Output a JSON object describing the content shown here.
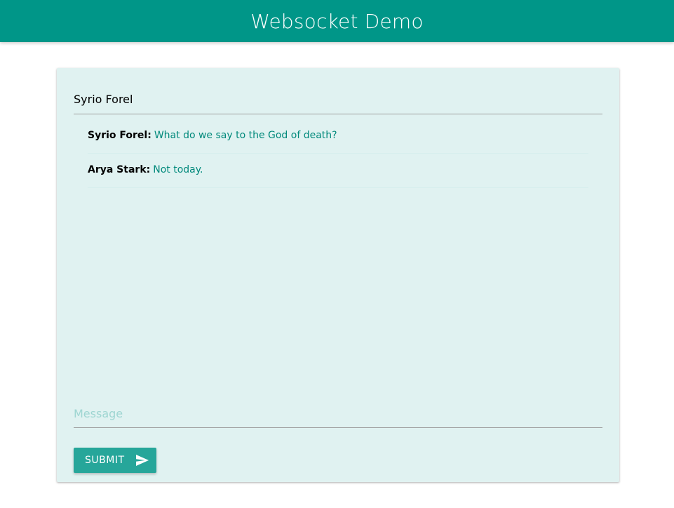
{
  "header": {
    "title": "Websocket Demo"
  },
  "chat": {
    "name_value": "Syrio Forel",
    "messages": [
      {
        "author": "Syrio Forel:",
        "text": "What do we say to the God of death?"
      },
      {
        "author": "Arya Stark:",
        "text": "Not today."
      }
    ],
    "message_placeholder": "Message",
    "message_value": "",
    "submit_label": "SUBMIT",
    "submit_icon": "send-icon"
  },
  "colors": {
    "primary": "#009688",
    "button": "#26a69a",
    "card_background": "#e0f2f1",
    "message_text": "#00897b"
  }
}
